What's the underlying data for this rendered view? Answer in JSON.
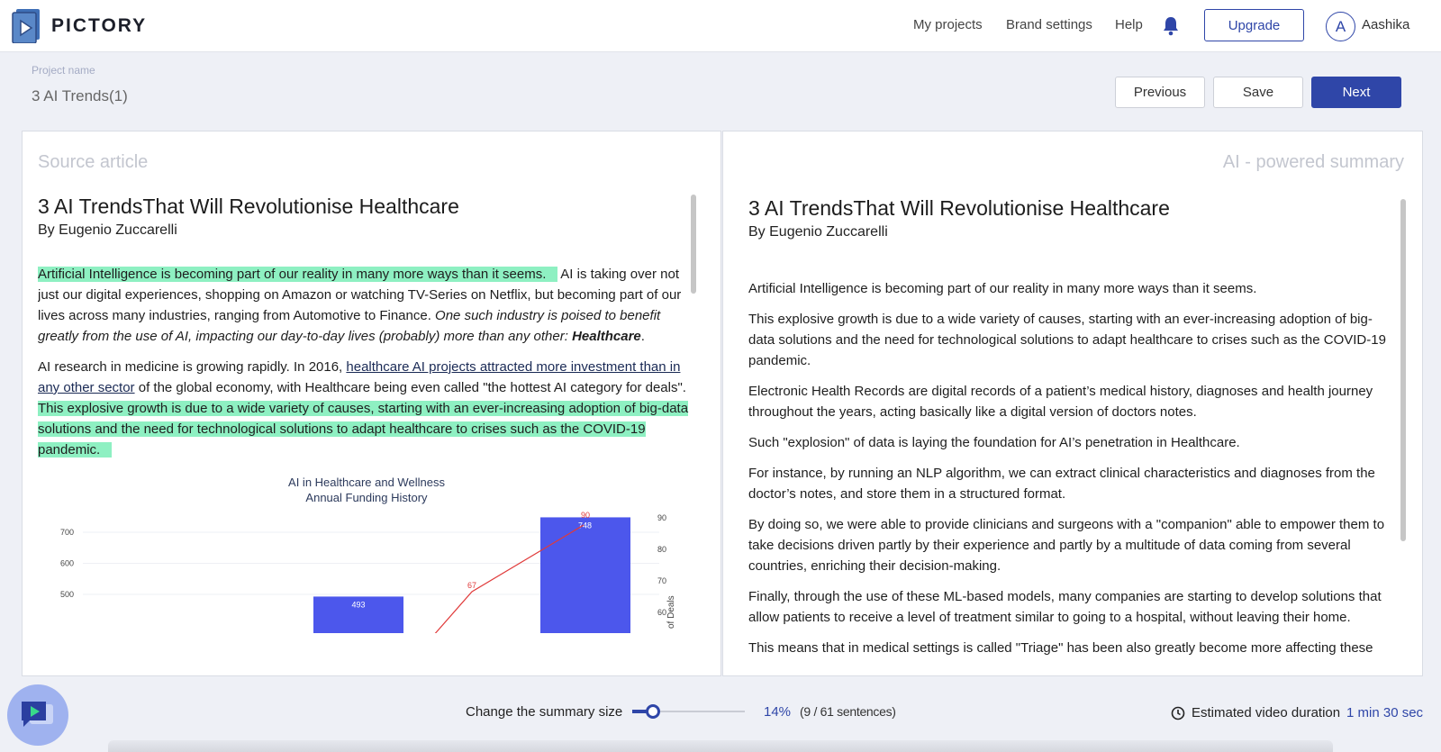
{
  "app": {
    "brand": "PICTORY"
  },
  "nav": {
    "links": [
      "My projects",
      "Brand settings",
      "Help"
    ],
    "upgrade_label": "Upgrade",
    "avatar_initial": "A",
    "username": "Aashika"
  },
  "project": {
    "label": "Project name",
    "name": "3 AI Trends(1)",
    "previous_label": "Previous",
    "save_label": "Save",
    "next_label": "Next"
  },
  "source": {
    "heading": "Source article",
    "title": "3 AI TrendsThat Will Revolutionise Healthcare",
    "author": "By Eugenio Zuccarelli",
    "p1_hl": "Artificial Intelligence is becoming part of our reality in many more ways than it seems.",
    "p1_text": "AI is taking over not just our digital experiences, shopping on Amazon or watching TV-Series on Netflix, but becoming part of our lives across many industries, ranging from Automotive to Finance.",
    "p1_italic": "One such industry is poised to benefit greatly from the use of AI, impacting our day-to-day lives (probably) more than any other:",
    "p1_bold": "Healthcare",
    "p2_text1": "AI research in medicine is growing rapidly. In 2016,",
    "p2_link": "healthcare AI projects attracted more investment than in any other sector",
    "p2_text2": "of the global economy, with Healthcare being even called \"the hottest AI category for deals\".",
    "p2_hl": "This explosive growth is due to a wide variety of causes, starting with an ever-increasing adoption of big-data solutions and the need for technological solutions to adapt healthcare to crises such as the COVID-19 pandemic."
  },
  "chart_data": {
    "type": "bar",
    "title": "AI in Healthcare and Wellness",
    "subtitle": "Annual Funding History",
    "xlabel": "",
    "ylabel": "",
    "y2label": "of Deals",
    "left_ticks": [
      "700",
      "600",
      "500"
    ],
    "right_ticks": [
      "90",
      "80",
      "70",
      "60"
    ],
    "bars": [
      493,
      748
    ],
    "line_points": [
      67,
      90
    ],
    "bar_color": "#4c57ec",
    "line_color": "#e03a3a"
  },
  "summary": {
    "heading": "AI - powered summary",
    "title": "3 AI TrendsThat Will Revolutionise Healthcare",
    "author": "By Eugenio Zuccarelli",
    "paragraphs": [
      "Artificial Intelligence is becoming part of our reality in many more ways than it seems.",
      "This explosive growth is due to a wide variety of causes, starting with an ever-increasing adoption of big-data solutions and the need for technological solutions to adapt healthcare to crises such as the COVID-19 pandemic.",
      "Electronic Health Records are digital records of a patient’s medical history, diagnoses and health journey throughout the years, acting basically like a digital version of doctors notes.",
      "Such \"explosion\" of data is laying the foundation for AI’s penetration in Healthcare.",
      "For instance, by running an NLP algorithm, we can extract clinical characteristics and diagnoses from the doctor’s notes, and store them in a structured format.",
      "By doing so, we were able to provide clinicians and surgeons with a \"companion\" able to empower them to take decisions driven partly by their experience and partly by a multitude of data coming from several countries, enriching their decision-making.",
      "Finally, through the use of these ML-based models, many companies are starting to develop solutions that allow patients to receive a level of treatment similar to going to a hospital, without leaving their home.",
      "This means that in medical settings is called \"Triage\" has been also greatly become more affecting these"
    ]
  },
  "footer": {
    "summary_size_label": "Change the summary size",
    "summary_fraction": 0.14,
    "percent": "14%",
    "sentences": "(9 / 61 sentences)",
    "duration_label": "Estimated video duration",
    "duration_value": "1 min 30 sec"
  },
  "colors": {
    "accent": "#2f46a8",
    "highlight": "#8ef0c2"
  }
}
